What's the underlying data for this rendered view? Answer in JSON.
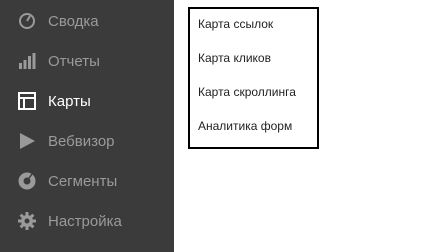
{
  "sidebar": {
    "items": [
      {
        "label": "Сводка",
        "icon": "dashboard-gauge-icon"
      },
      {
        "label": "Отчеты",
        "icon": "bar-chart-icon"
      },
      {
        "label": "Карты",
        "icon": "layout-map-icon",
        "active": true
      },
      {
        "label": "Вебвизор",
        "icon": "play-icon"
      },
      {
        "label": "Сегменты",
        "icon": "donut-segment-icon"
      },
      {
        "label": "Настройка",
        "icon": "gear-icon"
      }
    ]
  },
  "submenu": {
    "items": [
      {
        "label": "Карта ссылок"
      },
      {
        "label": "Карта кликов"
      },
      {
        "label": "Карта скроллинга"
      },
      {
        "label": "Аналитика форм"
      }
    ]
  },
  "colors": {
    "sidebar_bg": "#3b3b3b",
    "item_text": "#9a9a9a",
    "active_text": "#ffffff",
    "popup_border": "#000000"
  }
}
